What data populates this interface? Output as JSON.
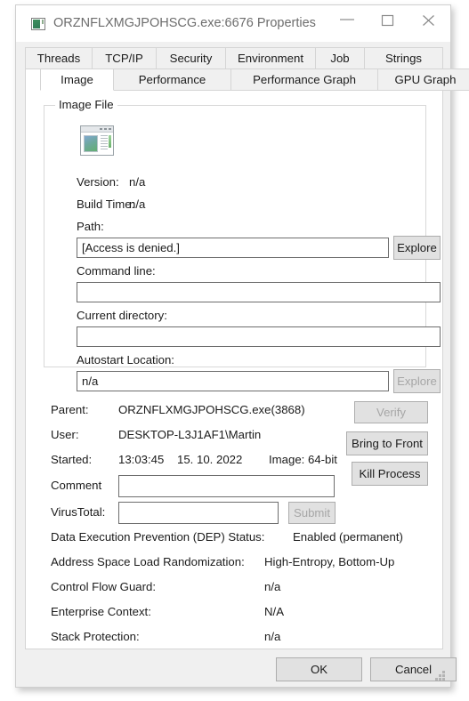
{
  "window": {
    "title": "ORZNFLXMGJPOHSCG.exe:6676 Properties",
    "icon": "process-window-icon",
    "minimize_icon": "minimize-icon",
    "maximize_icon": "maximize-icon",
    "close_icon": "close-icon",
    "accent_disabled_color": "#a6a6a6",
    "title_color": "#6d6d6d"
  },
  "tabs": {
    "row1": [
      {
        "label": "Threads",
        "selected": false
      },
      {
        "label": "TCP/IP",
        "selected": false
      },
      {
        "label": "Security",
        "selected": false
      },
      {
        "label": "Environment",
        "selected": false
      },
      {
        "label": "Job",
        "selected": false
      },
      {
        "label": "Strings",
        "selected": false
      }
    ],
    "row2": [
      {
        "label": "Image",
        "selected": true
      },
      {
        "label": "Performance",
        "selected": false
      },
      {
        "label": "Performance Graph",
        "selected": false
      },
      {
        "label": "GPU Graph",
        "selected": false
      }
    ]
  },
  "image_file": {
    "group_title": "Image File",
    "app_icon": "application-thumbnail-icon",
    "version_label": "Version:",
    "version_value": "n/a",
    "build_time_label": "Build Time:",
    "build_time_value": "n/a",
    "path_label": "Path:",
    "path_value": "[Access is denied.]",
    "path_explore_label": "Explore",
    "path_explore_enabled": true,
    "command_line_label": "Command line:",
    "command_line_value": "",
    "current_directory_label": "Current directory:",
    "current_directory_value": "",
    "autostart_label": "Autostart Location:",
    "autostart_value": "n/a",
    "autostart_explore_label": "Explore",
    "autostart_explore_enabled": false
  },
  "details": {
    "parent_label": "Parent:",
    "parent_value": "ORZNFLXMGJPOHSCG.exe(3868)",
    "user_label": "User:",
    "user_value": "DESKTOP-L3J1AF1\\Martin",
    "started_label": "Started:",
    "started_time": "13:03:45",
    "started_date": "15. 10. 2022",
    "image_bits": "Image: 64-bit",
    "comment_label": "Comment",
    "comment_value": "",
    "virustotal_label": "VirusTotal:",
    "virustotal_value": "",
    "submit_label": "Submit",
    "submit_enabled": false
  },
  "actions": {
    "verify_label": "Verify",
    "verify_enabled": false,
    "bring_to_front_label": "Bring to Front",
    "bring_to_front_enabled": true,
    "kill_process_label": "Kill Process",
    "kill_process_enabled": true
  },
  "mitigations": [
    {
      "label": "Data Execution Prevention (DEP) Status:",
      "value": "Enabled (permanent)"
    },
    {
      "label": "Address Space Load Randomization:",
      "value": "High-Entropy, Bottom-Up"
    },
    {
      "label": "Control Flow Guard:",
      "value": "n/a"
    },
    {
      "label": "Enterprise Context:",
      "value": "N/A"
    },
    {
      "label": "Stack Protection:",
      "value": "n/a"
    }
  ],
  "footer": {
    "ok_label": "OK",
    "cancel_label": "Cancel",
    "resize_grip": "resize-grip-icon"
  }
}
